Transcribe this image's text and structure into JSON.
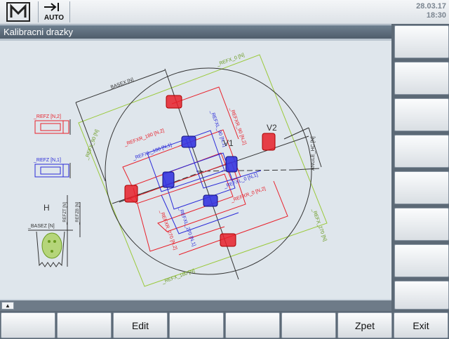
{
  "header": {
    "date": "28.03.17",
    "time": "18:30",
    "mode": "AUTO"
  },
  "window": {
    "title": "Kalibracni drazky"
  },
  "drawing": {
    "labels": {
      "h": "H",
      "v1": "V1",
      "v2": "V2",
      "base_x": "_BASEX [N]",
      "base_z": "_BASEZ [N]",
      "refz_2": "_REFZ [N,2]",
      "refz_1": "_REFZ [N,1]",
      "ref_zt": "_REFZT [N]",
      "ref_zb": "_REFZB [N]",
      "angle": "ANGLE_HC [N]",
      "refx_0": "_REFX_0 [N]",
      "refx_180": "_REFX_180 [N]",
      "refx_90": "_REFX_90 [N]",
      "refx_270": "_REFX_270 [N]",
      "refxr_90_2": "_REFXR_90 [N,2]",
      "refxl_90_1": "_REFXL_90 [N,1]",
      "refxr_180_2": "_REFXR_180 [N,2]",
      "refxl_180_1": "_REFXL_180 [N,1]",
      "refxl_0_1": "_REFXL_0 [N,1]",
      "refxr_0_2": "_REFXR_0 [N,2]",
      "refxl_270_1": "_REFXL_270 [N,1]",
      "refxr_270_2": "_REFXR_270 [N,2]"
    },
    "colors": {
      "red": "#e8202a",
      "blue": "#2a2ad8",
      "green": "#9ac93a",
      "dark": "#333333"
    }
  },
  "softkeys": {
    "vertical": [
      "",
      "",
      "",
      "",
      "",
      "",
      "",
      ""
    ],
    "horizontal": [
      "",
      "",
      "Edit",
      "",
      "",
      "",
      "Zpet",
      "Exit"
    ]
  },
  "icons": {
    "logo": "machine-logo-icon",
    "mode": "auto-mode-icon",
    "scroll": "scroll-up-icon"
  }
}
